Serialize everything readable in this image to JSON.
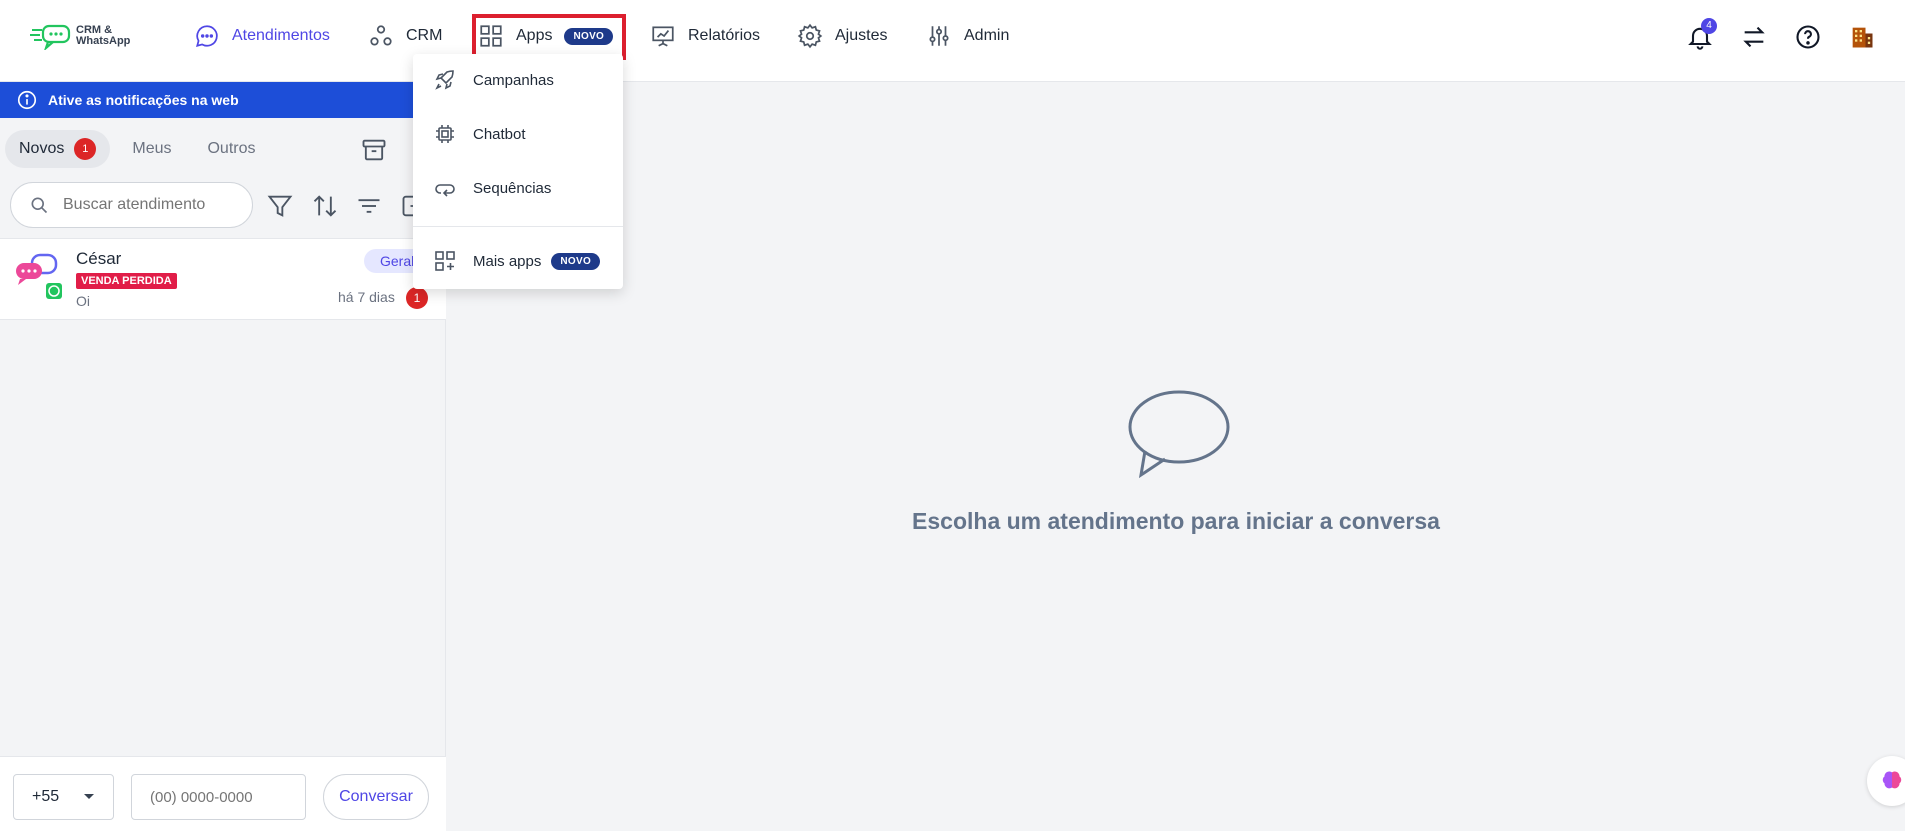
{
  "app": {
    "logo_line1": "CRM &",
    "logo_line2": "WhatsApp"
  },
  "nav": {
    "atendimentos": "Atendimentos",
    "crm": "CRM",
    "apps": "Apps",
    "apps_badge": "NOVO",
    "relatorios": "Relatórios",
    "ajustes": "Ajustes",
    "admin": "Admin",
    "notification_count": "4"
  },
  "apps_menu": {
    "items": [
      {
        "label": "Campanhas",
        "icon": "rocket-icon"
      },
      {
        "label": "Chatbot",
        "icon": "chip-icon"
      },
      {
        "label": "Sequências",
        "icon": "loop-icon"
      }
    ],
    "more_label": "Mais apps",
    "more_badge": "NOVO"
  },
  "banner": {
    "text": "Ative as notificações na web"
  },
  "tabs": {
    "novos": "Novos",
    "novos_count": "1",
    "meus": "Meus",
    "outros": "Outros"
  },
  "search": {
    "placeholder": "Buscar atendimento"
  },
  "conversations": [
    {
      "name": "César",
      "tag": "VENDA PERDIDA",
      "message": "Oi",
      "queue": "Geral",
      "time": "há 7 dias",
      "unread": "1"
    }
  ],
  "new_chat": {
    "country_code": "+55",
    "phone_placeholder": "(00) 0000-0000",
    "button": "Conversar"
  },
  "empty_state": {
    "text": "Escolha um atendimento para iniciar a conversa"
  },
  "colors": {
    "primary": "#4f46e5",
    "banner": "#1d4ed8",
    "badge": "#1e3a8a",
    "danger": "#dc2626",
    "highlight_box": "#dc1f2e"
  }
}
